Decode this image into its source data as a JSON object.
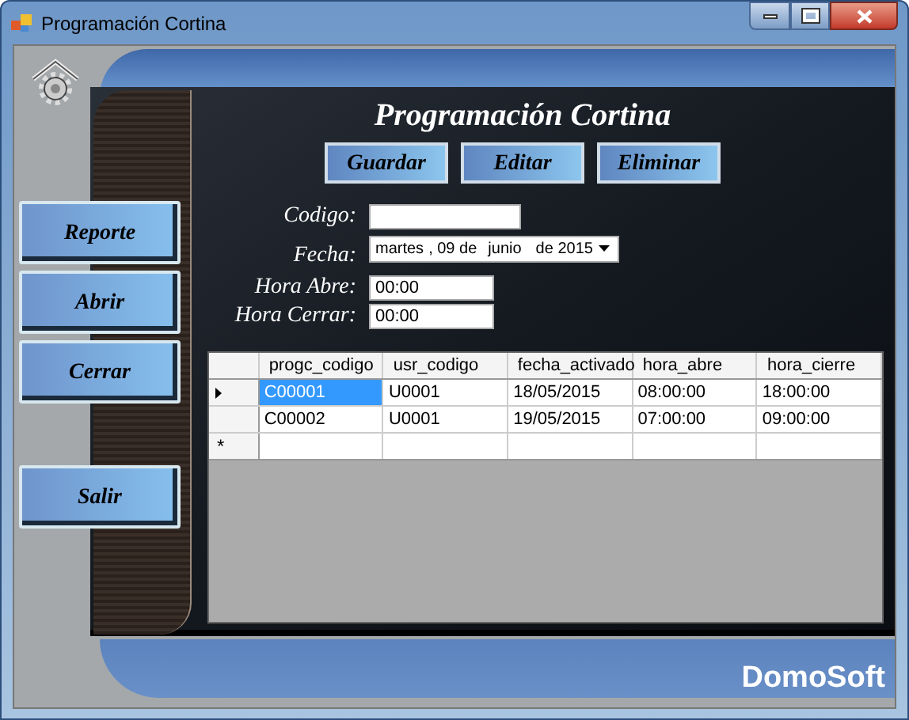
{
  "window": {
    "title": "Programación Cortina"
  },
  "side_buttons": [
    {
      "label": "Reporte"
    },
    {
      "label": "Abrir"
    },
    {
      "label": "Cerrar"
    },
    {
      "label": "Salir"
    }
  ],
  "heading": "Programación Cortina",
  "actions": [
    "Guardar",
    "Editar",
    "Eliminar"
  ],
  "form": {
    "codigo": {
      "label": "Codigo:"
    },
    "fecha": {
      "label": "Fecha:",
      "weekday": "martes",
      "day": ", 09 de",
      "month": "junio",
      "year": "de 2015"
    },
    "hora_abre": {
      "label": "Hora Abre:",
      "value": "00:00"
    },
    "hora_cerrar": {
      "label": "Hora Cerrar:",
      "value": "00:00"
    }
  },
  "table": {
    "columns": [
      "progc_codigo",
      "usr_codigo",
      "fecha_activado",
      "hora_abre",
      "hora_cierre"
    ],
    "rows": [
      {
        "current": true,
        "cells": [
          {
            "text": "C00001",
            "selected": true
          },
          {
            "text": "U0001",
            "selected": false
          },
          {
            "text": "18/05/2015",
            "selected": false
          },
          {
            "text": "08:00:00",
            "selected": false
          },
          {
            "text": "18:00:00",
            "selected": false
          }
        ]
      },
      {
        "current": false,
        "cells": [
          {
            "text": "C00002",
            "selected": false
          },
          {
            "text": "U0001",
            "selected": false
          },
          {
            "text": "19/05/2015",
            "selected": false
          },
          {
            "text": "07:00:00",
            "selected": false
          },
          {
            "text": "09:00:00",
            "selected": false
          }
        ]
      }
    ],
    "new_row_marker": "*"
  },
  "brand": "DomoSoft"
}
